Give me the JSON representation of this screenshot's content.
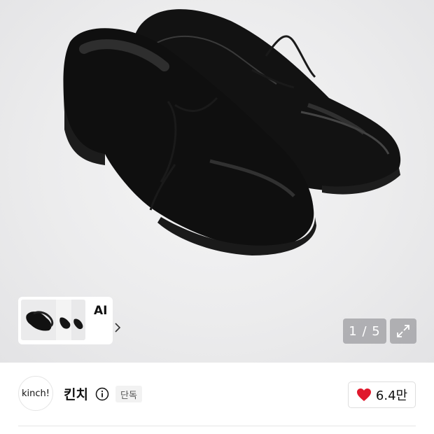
{
  "gallery": {
    "counter": "1 / 5",
    "ai_similar_label": "AI"
  },
  "brand": {
    "logo_text": "kinch!",
    "name": "킨치",
    "badge": "단독"
  },
  "likes": {
    "count": "6.4만"
  },
  "colors": {
    "heart": "#e0182c",
    "overlay": "#8c8c91"
  }
}
